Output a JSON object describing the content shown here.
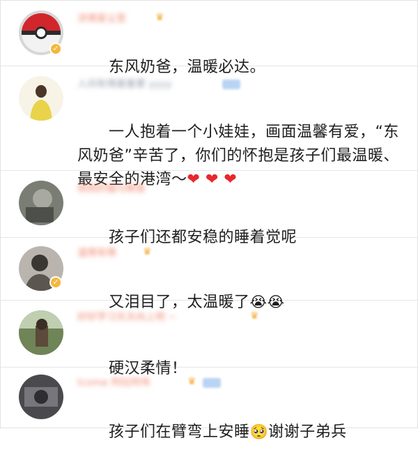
{
  "comments": [
    {
      "username": "凉情爱尘宽",
      "text": "东风奶爸，温暖必达。",
      "emoji": ""
    },
    {
      "username": "人间有情最重要 yyyy",
      "text": "一人抱着一个小娃娃，画面温馨有爱，“东风奶爸”辛苦了，你们的怀抱是孩子们最温暖、最安全的港湾～",
      "emoji": "❤ ❤ ❤"
    },
    {
      "username": "雨雨的猫与鲸鱼",
      "text": "孩子们还都安稳的睡着觉呢",
      "emoji": ""
    },
    {
      "username": "温情有情",
      "text": "又泪目了，太温暖了",
      "emoji": "😭😭"
    },
    {
      "username": "好好学习天天向上吧 ~",
      "text": "硬汉柔情！",
      "emoji": ""
    },
    {
      "username": "tcome 阿拉阿伟",
      "text": "孩子们在臂弯上安睡",
      "emoji": "🥺",
      "suffix": "谢谢子弟兵"
    }
  ],
  "badges": {
    "vip": "✓"
  },
  "colors": {
    "name_orange": "#f08c74",
    "name_gray": "#9aa3b0",
    "heart": "#e8272c"
  }
}
